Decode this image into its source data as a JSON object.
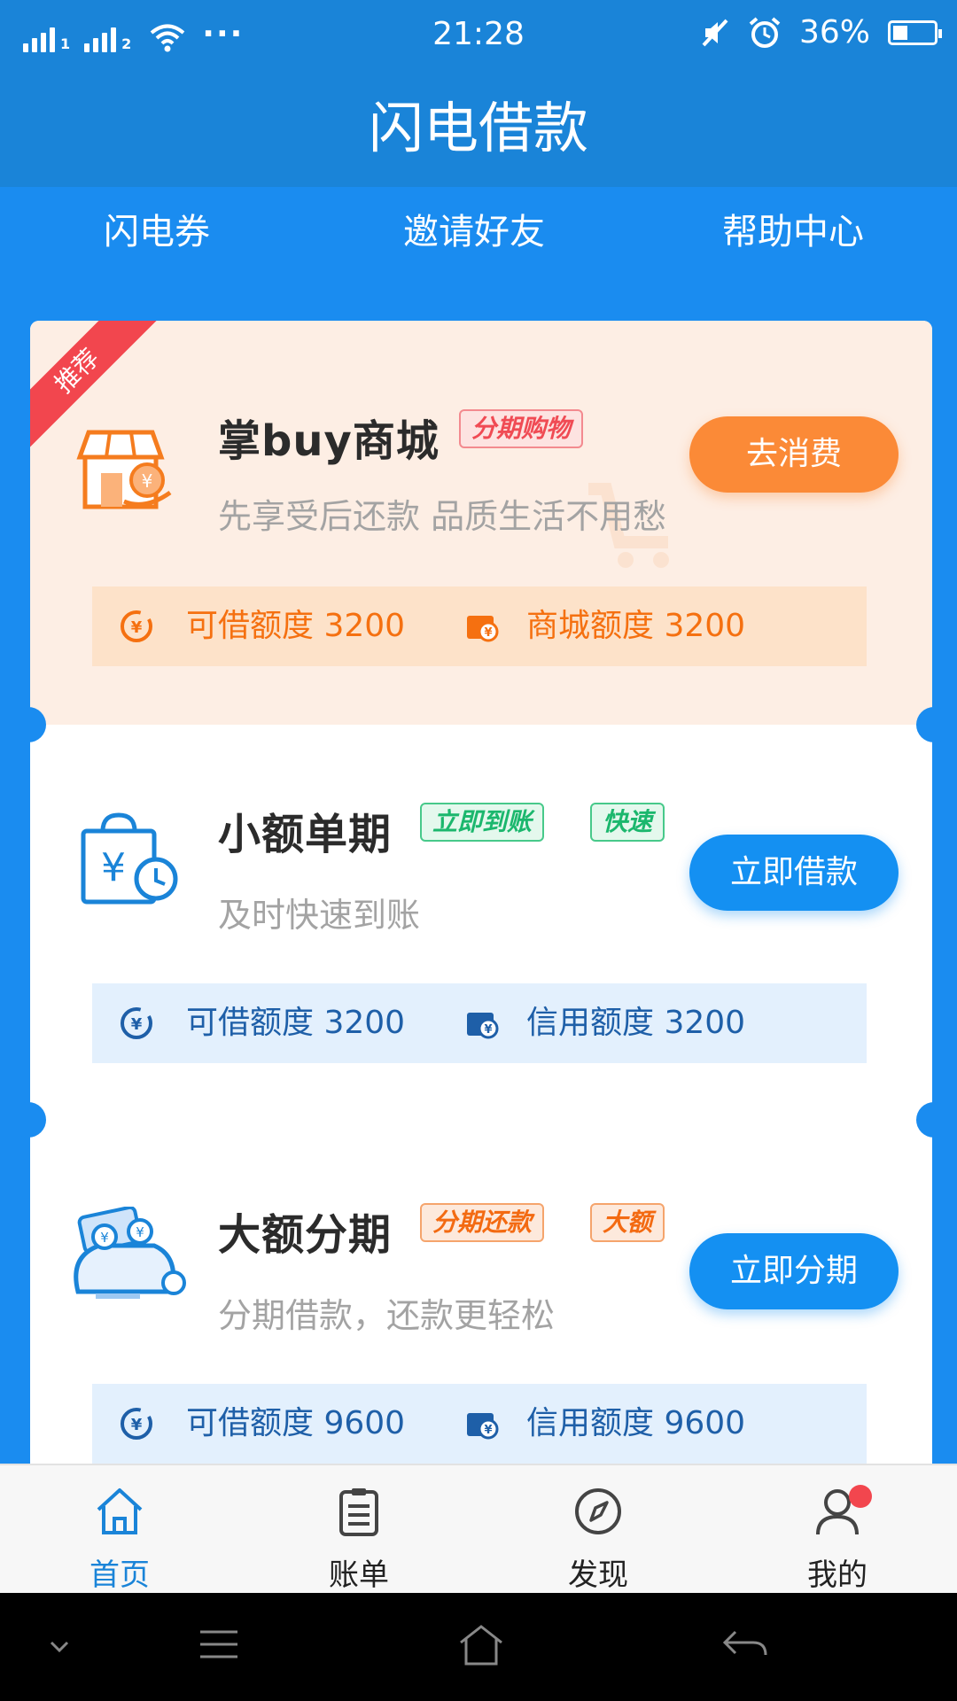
{
  "status_bar": {
    "sim1": "1",
    "sim2": "2",
    "more": "···",
    "time": "21:28",
    "battery": "36%",
    "battery_level": 0.36
  },
  "title": "闪电借款",
  "top_nav": [
    "闪电券",
    "邀请好友",
    "帮助中心"
  ],
  "products": [
    {
      "ribbon": "推荐",
      "name": "掌buy商城",
      "tags": [
        "分期购物"
      ],
      "desc": "先享受后还款 品质生活不用愁",
      "button": "去消费",
      "quota_left": "可借额度 3200",
      "quota_right": "商城额度 3200",
      "accent": "#fb8a37"
    },
    {
      "name": "小额单期",
      "tags": [
        "立即到账",
        "快速"
      ],
      "desc": "及时快速到账",
      "button": "立即借款",
      "quota_left": "可借额度 3200",
      "quota_right": "信用额度 3200",
      "accent": "#1490f2"
    },
    {
      "name": "大额分期",
      "tags": [
        "分期还款",
        "大额"
      ],
      "desc": "分期借款，还款更轻松",
      "button": "立即分期",
      "quota_left": "可借额度 9600",
      "quota_right": "信用额度 9600",
      "accent": "#1490f2"
    }
  ],
  "tab_bar": [
    {
      "label": "首页",
      "icon": "home-icon",
      "active": true
    },
    {
      "label": "账单",
      "icon": "clipboard-icon",
      "active": false
    },
    {
      "label": "发现",
      "icon": "compass-icon",
      "active": false
    },
    {
      "label": "我的",
      "icon": "user-icon",
      "active": false,
      "badge": true
    }
  ],
  "system_nav": [
    "chevron-down-icon",
    "menu-icon",
    "home-outline-icon",
    "back-icon"
  ]
}
